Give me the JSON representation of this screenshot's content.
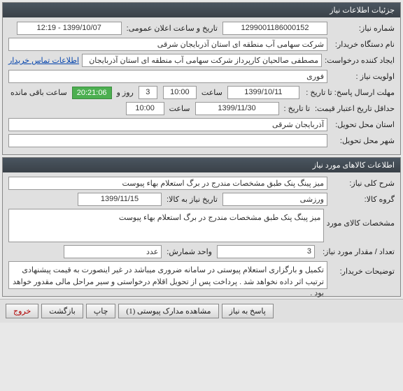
{
  "section1": {
    "title": "جزئیات اطلاعات نیاز",
    "need_number_label": "شماره نیاز:",
    "need_number": "1299001186000152",
    "announce_label": "تاریخ و ساعت اعلان عمومی:",
    "announce_value": "1399/10/07 - 12:19",
    "buyer_org_label": "نام دستگاه خریدار:",
    "buyer_org": "شرکت سهامی آب منطقه ای استان آذربایجان شرقی",
    "creator_label": "ایجاد کننده درخواست:",
    "creator": "مصطفی صالحیان کارپرداز شرکت سهامی آب منطقه ای استان آذربایجان شرقی",
    "creator_link": "اطلاعات تماس خریدار",
    "priority_label": "اولویت نیاز :",
    "priority": "فوری",
    "deadline_label": "مهلت ارسال پاسخ:  تا تاریخ :",
    "deadline_date": "1399/10/11",
    "deadline_time_label": "ساعت",
    "deadline_time": "10:00",
    "days_left": "3",
    "days_word": "روز و",
    "countdown": "20:21:06",
    "hours_word": "ساعت باقی مانده",
    "min_credit_label": "حداقل تاریخ اعتبار قیمت:",
    "min_credit_to_label": "تا تاریخ :",
    "min_credit_date": "1399/11/30",
    "min_credit_time_label": "ساعت",
    "min_credit_time": "10:00",
    "province_label": "استان محل تحویل:",
    "province": "آذربایجان شرقی",
    "city_label": "شهر محل تحویل:",
    "city": ""
  },
  "section2": {
    "title": "اطلاعات کالاهای مورد نیاز",
    "general_desc_label": "شرح کلی نیاز:",
    "general_desc": "میز پینگ پنک طبق مشخصات مندرج در برگ استعلام بهاء پیوست",
    "group_label": "گروه کالا:",
    "group": "ورزشی",
    "need_date_label": "تاریخ نیاز به کالا:",
    "need_date": "1399/11/15",
    "spec_label": "مشخصات کالای مورد نیاز:",
    "spec": "میز پینگ پنک طبق مشخصات مندرج در برگ استعلام بهاء پیوست",
    "qty_label": "تعداد / مقدار مورد نیاز:",
    "qty": "3",
    "unit_label": "واحد شمارش:",
    "unit": "عدد",
    "notes_label": "توضیحات خریدار:",
    "notes": "تکمیل و بارگزاری استعلام پیوستی در سامانه ضروری میباشد در غیر اینصورت به قیمت پیشنهادی ترتیب اثر داده نخواهد شد . پرداخت پس از تحویل اقلام درخواستی و سیر مراحل مالی مقدور خواهد بود ."
  },
  "footer": {
    "respond": "پاسخ به نیاز",
    "attachments": "مشاهده مدارک پیوستی  (1)",
    "print": "چاپ",
    "back": "بازگشت",
    "exit": "خروج"
  }
}
